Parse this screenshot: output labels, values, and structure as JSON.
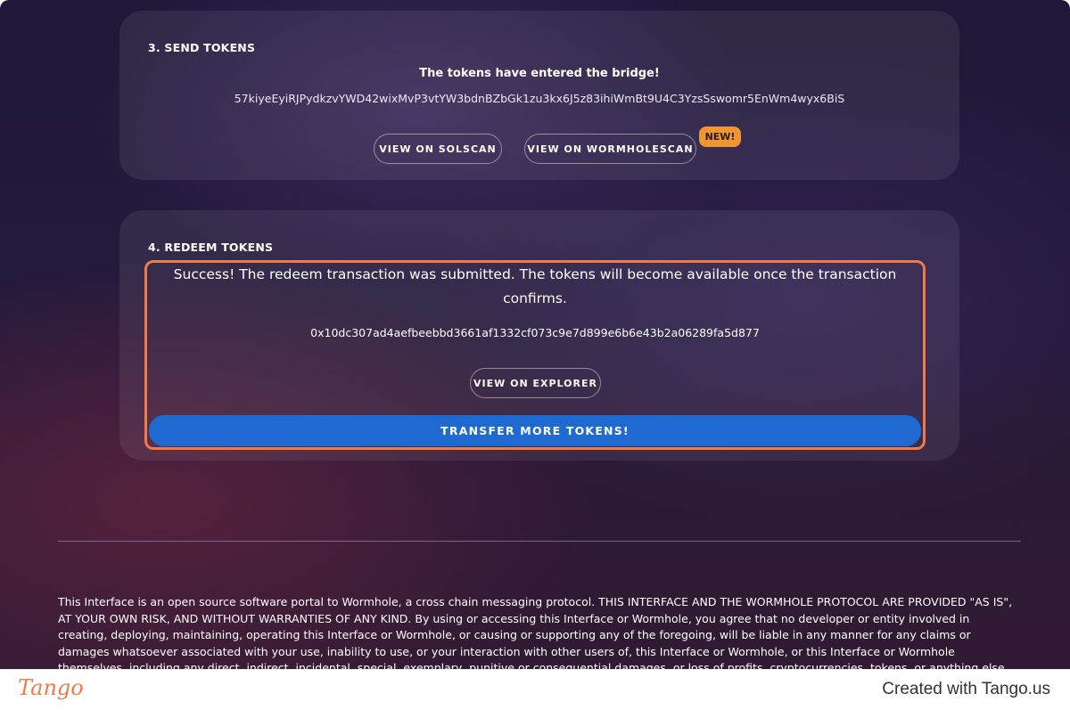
{
  "send": {
    "title": "3. SEND TOKENS",
    "message": "The tokens have entered the bridge!",
    "tx_hash": "57kiyeEyiRJPydkzvYWD42wixMvP3vtYW3bdnBZbGk1zu3kx6J5z83ihiWmBt9U4C3YzsSswomr5EnWm4wyx6BiS",
    "solscan_button": "VIEW ON SOLSCAN",
    "wormholescan_button": "VIEW ON WORMHOLESCAN",
    "new_badge": "NEW!"
  },
  "redeem": {
    "title": "4. REDEEM TOKENS",
    "success_message": "Success! The redeem transaction was submitted. The tokens will become available once the transaction confirms.",
    "tx_hash": "0x10dc307ad4aefbeebbd3661af1332cf073c9e7d899e6b6e43b2a06289fa5d877",
    "explorer_button": "VIEW ON EXPLORER",
    "transfer_button": "TRANSFER MORE TOKENS!"
  },
  "disclaimer": "This Interface is an open source software portal to Wormhole, a cross chain messaging protocol. THIS INTERFACE AND THE WORMHOLE PROTOCOL ARE PROVIDED \"AS IS\", AT YOUR OWN RISK, AND WITHOUT WARRANTIES OF ANY KIND. By using or accessing this Interface or Wormhole, you agree that no developer or entity involved in creating, deploying, maintaining, operating this Interface or Wormhole, or causing or supporting any of the foregoing, will be liable in any manner for any claims or damages whatsoever associated with your use, inability to use, or your interaction with other users of, this Interface or Wormhole, or this Interface or Wormhole themselves, including any direct, indirect, incidental, special, exemplary, punitive or consequential damages, or loss of profits, cryptocurrencies, tokens, or anything else of value.",
  "footer": {
    "logo": "Tango",
    "created_with": "Created with Tango.us"
  },
  "colors": {
    "accent_blue": "#1f6ad0",
    "highlight_orange": "#ef7a4a",
    "badge_orange": "#f0962e"
  }
}
